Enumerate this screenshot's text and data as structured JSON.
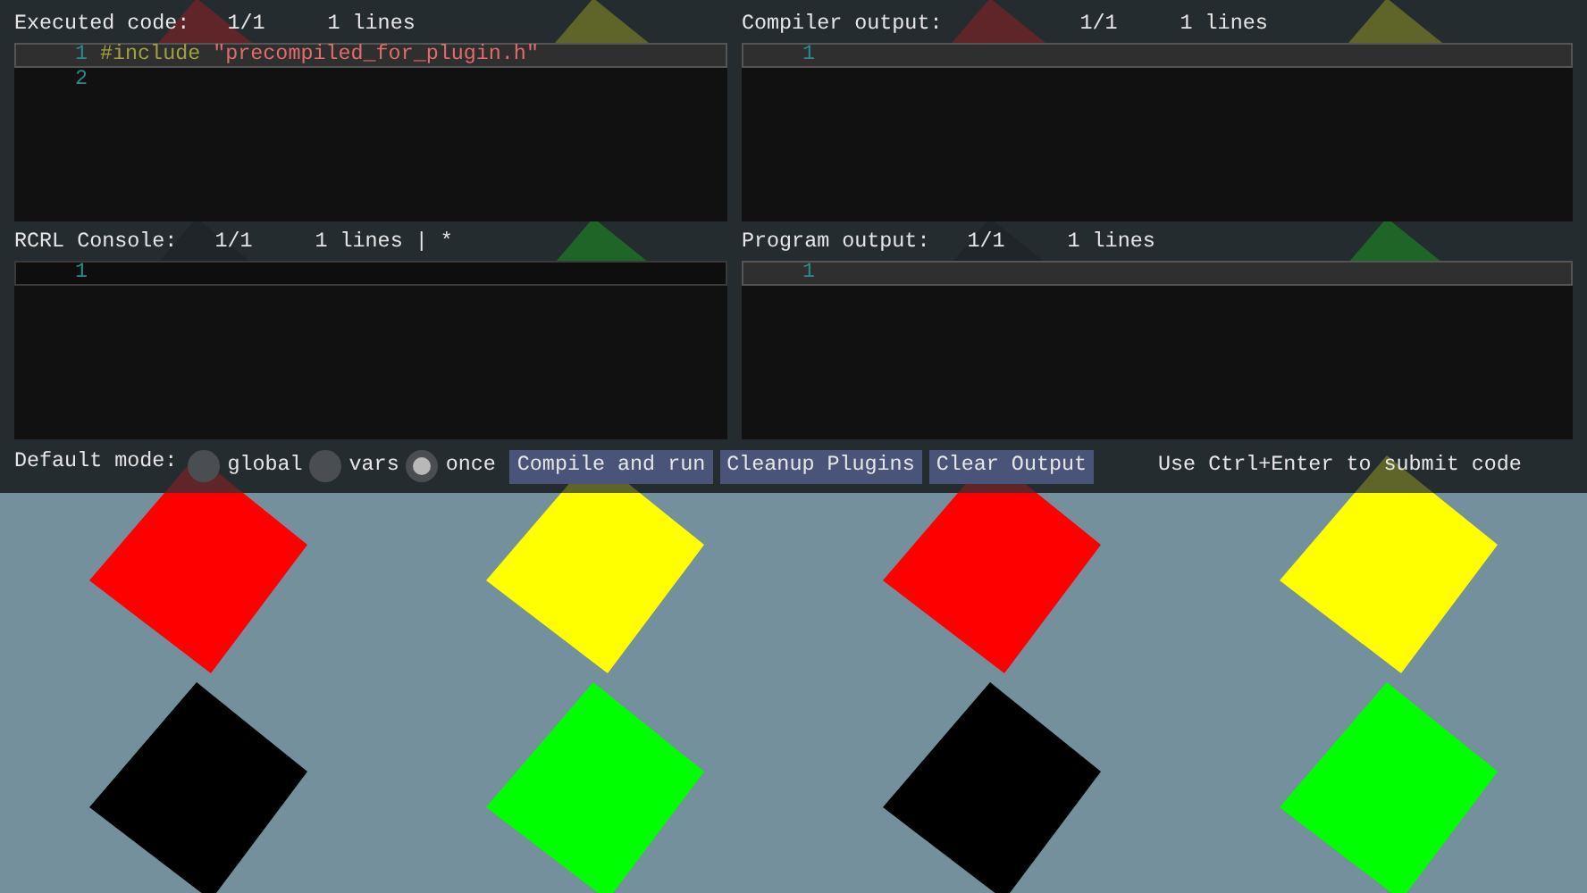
{
  "panels": [
    {
      "title": "Executed code:",
      "position": "1/1",
      "line_count": "1 lines",
      "focused": false,
      "lines": [
        {
          "number": "1",
          "current": true,
          "tokens": [
            {
              "kind": "preprocessor",
              "text": "#include"
            },
            {
              "kind": "string",
              "text": "\"precompiled_for_plugin.h\""
            }
          ]
        },
        {
          "number": "2",
          "current": false
        }
      ]
    },
    {
      "title": "Compiler output:",
      "position": "1/1",
      "line_count": "1 lines",
      "focused": false,
      "lines": [
        {
          "number": "1",
          "current": true
        }
      ]
    },
    {
      "title": "RCRL Console:",
      "position": "1/1",
      "line_count": "1 lines | *",
      "focused": true,
      "lines": [
        {
          "number": "1",
          "current": true
        }
      ]
    },
    {
      "title": "Program output:",
      "position": "1/1",
      "line_count": "1 lines",
      "focused": false,
      "lines": [
        {
          "number": "1",
          "current": true
        }
      ]
    }
  ],
  "mode": {
    "label": "Default mode:",
    "options": [
      {
        "label": "global",
        "selected": false
      },
      {
        "label": "vars",
        "selected": false
      },
      {
        "label": "once",
        "selected": true
      }
    ]
  },
  "buttons": [
    "Compile and run",
    "Cleanup Plugins",
    "Clear Output"
  ],
  "hint": "Use Ctrl+Enter to submit code"
}
